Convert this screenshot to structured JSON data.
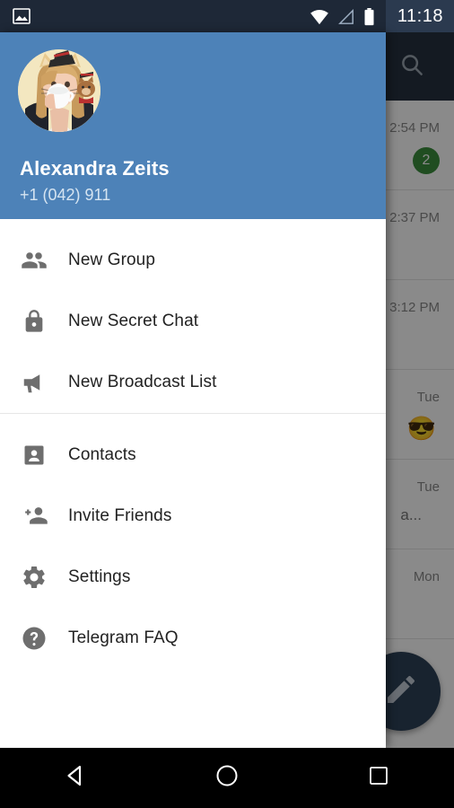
{
  "status_bar": {
    "time": "11:18",
    "left_icon": "image-icon",
    "icons": [
      "wifi-icon",
      "cellular-signal-icon",
      "battery-icon"
    ]
  },
  "chat_list": {
    "toolbar": {
      "search_icon": "search-icon"
    },
    "rows": [
      {
        "name": "",
        "message": "",
        "time": "2:54 PM",
        "badge": "2",
        "emoji": "",
        "avatar_color": "#8a8a8a"
      },
      {
        "name": "",
        "message": "",
        "time": "2:37 PM",
        "badge": "",
        "emoji": "",
        "avatar_color": "#8a8a8a"
      },
      {
        "name": "",
        "message": "",
        "time": "3:12 PM",
        "badge": "",
        "emoji": "",
        "avatar_color": "#8a8a8a"
      },
      {
        "name": "",
        "message": "",
        "time": "Tue",
        "badge": "",
        "emoji": "😎",
        "avatar_color": "#8a8a8a"
      },
      {
        "name": "",
        "message": "a...",
        "time": "Tue",
        "badge": "",
        "emoji": "",
        "avatar_color": "#8a8a8a"
      },
      {
        "name": "",
        "message": "",
        "time": "Mon",
        "badge": "",
        "emoji": "",
        "avatar_color": "#8a8a8a"
      }
    ],
    "fab": {
      "icon": "pencil-icon",
      "color": "#2d4157"
    }
  },
  "drawer": {
    "header": {
      "name": "Alexandra Zeits",
      "phone": "+1 (042) 911",
      "background_color": "#4d82b8",
      "avatar_alt": "user-profile-photo"
    },
    "groups": [
      {
        "items": [
          {
            "label": "New Group",
            "icon": "people-icon"
          },
          {
            "label": "New Secret Chat",
            "icon": "lock-icon"
          },
          {
            "label": "New Broadcast List",
            "icon": "megaphone-icon"
          }
        ]
      },
      {
        "items": [
          {
            "label": "Contacts",
            "icon": "contact-card-icon"
          },
          {
            "label": "Invite Friends",
            "icon": "person-add-icon"
          },
          {
            "label": "Settings",
            "icon": "gear-icon"
          },
          {
            "label": "Telegram FAQ",
            "icon": "help-circle-icon"
          }
        ]
      }
    ]
  },
  "nav_bar": {
    "back": "back-triangle-icon",
    "home": "home-circle-icon",
    "recents": "recents-square-icon"
  }
}
